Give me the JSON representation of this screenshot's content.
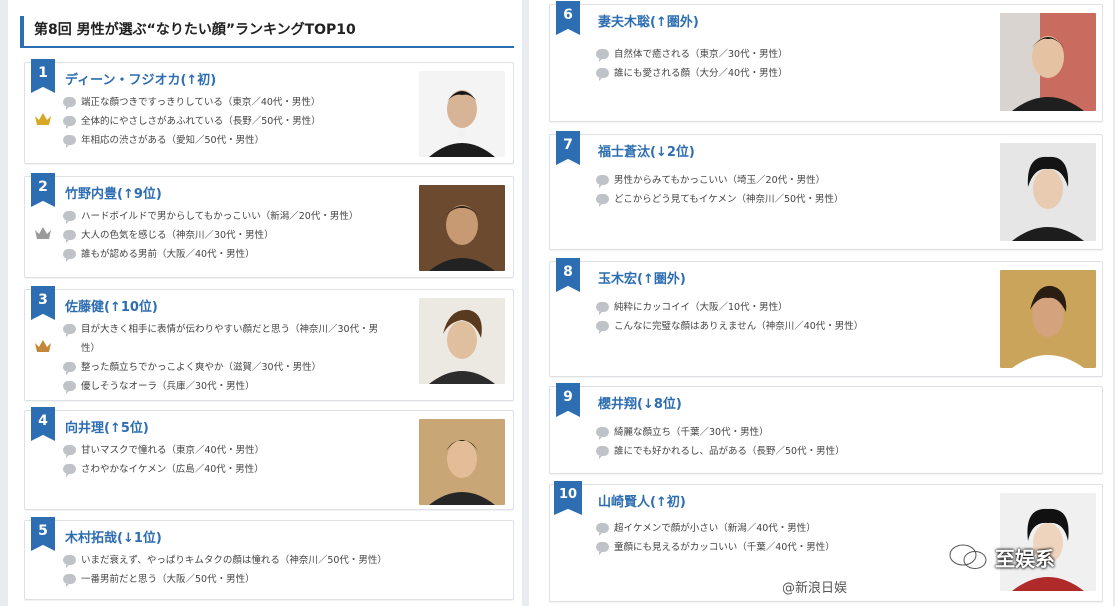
{
  "title": "第8回 男性が選ぶ“なりたい顔”ランキングTOP10",
  "crown_colors": {
    "1": "#d6a826",
    "2": "#9a9a9a",
    "3": "#c2873a"
  },
  "accent": "#2d6db2",
  "entries": [
    {
      "rank": "1",
      "name": "ディーン・フジオカ(↑初)",
      "comments": [
        "端正な顔つきですっきりしている（東京／40代・男性）",
        "全体的にやさしさがあふれている（長野／50代・男性）",
        "年相応の渋さがある（愛知／50代・男性）"
      ]
    },
    {
      "rank": "2",
      "name": "竹野内豊(↑9位)",
      "comments": [
        "ハードボイルドで男からしてもかっこいい（新潟／20代・男性）",
        "大人の色気を感じる（神奈川／30代・男性）",
        "誰もが認める男前（大阪／40代・男性）"
      ]
    },
    {
      "rank": "3",
      "name": "佐藤健(↑10位)",
      "comments": [
        "目が大きく相手に表情が伝わりやすい顔だと思う（神奈川／30代・男",
        "性）",
        "整った顔立ちでかっこよく爽やか（滋賀／30代・男性）",
        "優しそうなオーラ（兵庫／30代・男性）"
      ]
    },
    {
      "rank": "4",
      "name": "向井理(↑5位)",
      "comments": [
        "甘いマスクで憧れる（東京／40代・男性）",
        "さわやかなイケメン（広島／40代・男性）"
      ]
    },
    {
      "rank": "5",
      "name": "木村拓哉(↓1位)",
      "comments": [
        "いまだ衰えず、やっぱりキムタクの顔は憧れる（神奈川／50代・男性）",
        "一番男前だと思う（大阪／50代・男性）"
      ]
    },
    {
      "rank": "6",
      "name": "妻夫木聡(↑圏外)",
      "comments": [
        "自然体で癒される（東京／30代・男性）",
        "誰にも愛される顔（大分／40代・男性）"
      ]
    },
    {
      "rank": "7",
      "name": "福士蒼汰(↓2位)",
      "comments": [
        "男性からみてもかっこいい（埼玉／20代・男性）",
        "どこからどう見てもイケメン（神奈川／50代・男性）"
      ]
    },
    {
      "rank": "8",
      "name": "玉木宏(↑圏外)",
      "comments": [
        "純粋にカッコイイ（大阪／10代・男性）",
        "こんなに完璧な顔はありえません（神奈川／40代・男性）"
      ]
    },
    {
      "rank": "9",
      "name": "櫻井翔(↓8位)",
      "comments": [
        "綺麗な顔立ち（千葉／30代・男性）",
        "誰にでも好かれるし、品がある（長野／50代・男性）"
      ]
    },
    {
      "rank": "10",
      "name": "山崎賢人(↑初)",
      "comments": [
        "超イケメンで顔が小さい（新潟／40代・男性）",
        "童顔にも見えるがカッコいい（千葉／40代・男性）"
      ]
    }
  ],
  "watermark_sina": "@新浪日娱",
  "watermark_brand": "至娱系"
}
